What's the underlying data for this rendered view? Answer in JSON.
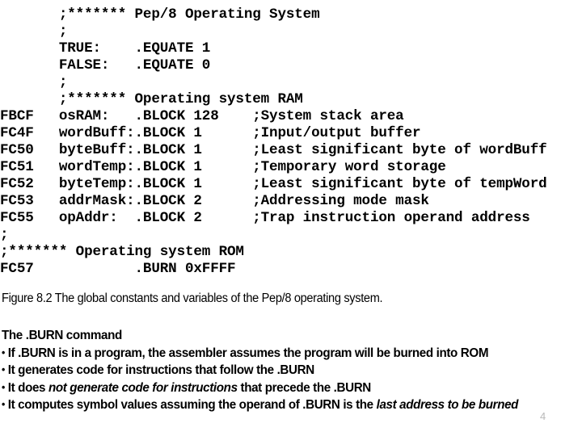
{
  "slide": {
    "page_number": "4",
    "background_color": "#ffffff",
    "text_color": "#000000",
    "page_number_color": "#b9b9b9"
  },
  "code_listing": {
    "columns": [
      "address",
      "symbol",
      "mnemonic",
      "operand",
      "comment"
    ],
    "lines": [
      "       ;******* Pep/8 Operating System",
      "       ;",
      "       TRUE:    .EQUATE 1",
      "       FALSE:   .EQUATE 0",
      "       ;",
      "       ;******* Operating system RAM",
      "FBCF   osRAM:   .BLOCK 128    ;System stack area",
      "FC4F   wordBuff:.BLOCK 1      ;Input/output buffer",
      "FC50   byteBuff:.BLOCK 1      ;Least significant byte of wordBuff",
      "FC51   wordTemp:.BLOCK 1      ;Temporary word storage",
      "FC52   byteTemp:.BLOCK 1      ;Least significant byte of tempWord",
      "FC53   addrMask:.BLOCK 2      ;Addressing mode mask",
      "FC55   opAddr:  .BLOCK 2      ;Trap instruction operand address",
      ";",
      ";******* Operating system ROM",
      "FC57            .BURN 0xFFFF"
    ]
  },
  "figure": {
    "caption": "Figure 8.2 The global constants and variables of the Pep/8 operating system."
  },
  "burn_section": {
    "heading": "The .BURN command",
    "bullet_glyph": "•",
    "bullets": [
      {
        "pre": "If .BURN is in a program, the assembler assumes the program will be burned into ROM",
        "italic": "",
        "post": ""
      },
      {
        "pre": "It generates code for instructions that follow the .BURN",
        "italic": "",
        "post": ""
      },
      {
        "pre": "It does ",
        "italic": "not generate code for instructions",
        "post": " that precede the .BURN"
      },
      {
        "pre": "It computes symbol values assuming the operand of .BURN is the ",
        "italic": "last address to be burned",
        "post": ""
      }
    ]
  }
}
